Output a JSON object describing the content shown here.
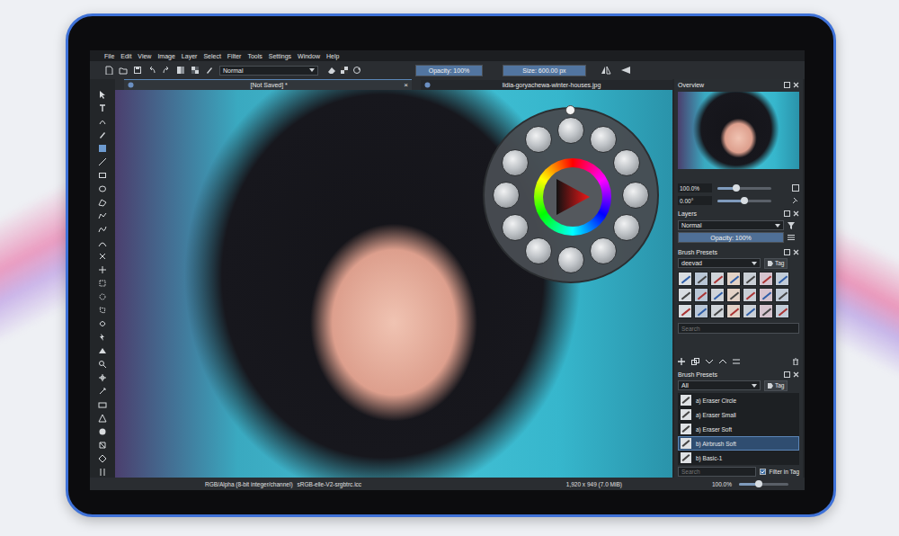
{
  "menu": [
    "File",
    "Edit",
    "View",
    "Image",
    "Layer",
    "Select",
    "Filter",
    "Tools",
    "Settings",
    "Window",
    "Help"
  ],
  "toolbar": {
    "blend_mode": "Normal",
    "opacity": {
      "label": "Opacity: 100%",
      "level": 1.0
    },
    "size": {
      "label": "Size: 600.00 px",
      "level": 1.0
    }
  },
  "tabs": [
    {
      "label": "[Not Saved] *",
      "selected": true,
      "close": "×"
    },
    {
      "label": "lidia-goryachewa-winter-houses.jpg",
      "selected": false
    }
  ],
  "overview": {
    "title": "Overview",
    "zoom": {
      "label": "100.0%",
      "level": 0.35
    },
    "rotation": {
      "label": "0.00°",
      "level": 0.5
    }
  },
  "layers": {
    "title": "Layers",
    "blend_mode": "Normal",
    "opacity": {
      "label": "Opacity: 100%",
      "level": 1.0
    }
  },
  "brush_presets_top": {
    "title": "Brush Presets",
    "tag_filter": "deevad",
    "tag_button": "Tag",
    "search_placeholder": "Search"
  },
  "brush_presets": {
    "title": "Brush Presets",
    "tag_filter": "All",
    "tag_button": "Tag",
    "items": [
      {
        "label": "a) Eraser Circle",
        "selected": false
      },
      {
        "label": "a) Eraser Small",
        "selected": false
      },
      {
        "label": "a) Eraser Soft",
        "selected": false
      },
      {
        "label": "b) Airbrush Soft",
        "selected": true
      },
      {
        "label": "b) Basic-1",
        "selected": false
      }
    ],
    "search_placeholder": "Search",
    "filter_in_tag": {
      "label": "Filter in Tag",
      "checked": true
    }
  },
  "status_bar": {
    "color_model": "RGB/Alpha (8-bit integer/channel)",
    "profile": "sRGB-elle-V2-srgbtrc.icc",
    "image_size": "1,920 x 949 (7.0 MiB)",
    "zoom": {
      "label": "100.0%",
      "level": 0.4
    }
  }
}
